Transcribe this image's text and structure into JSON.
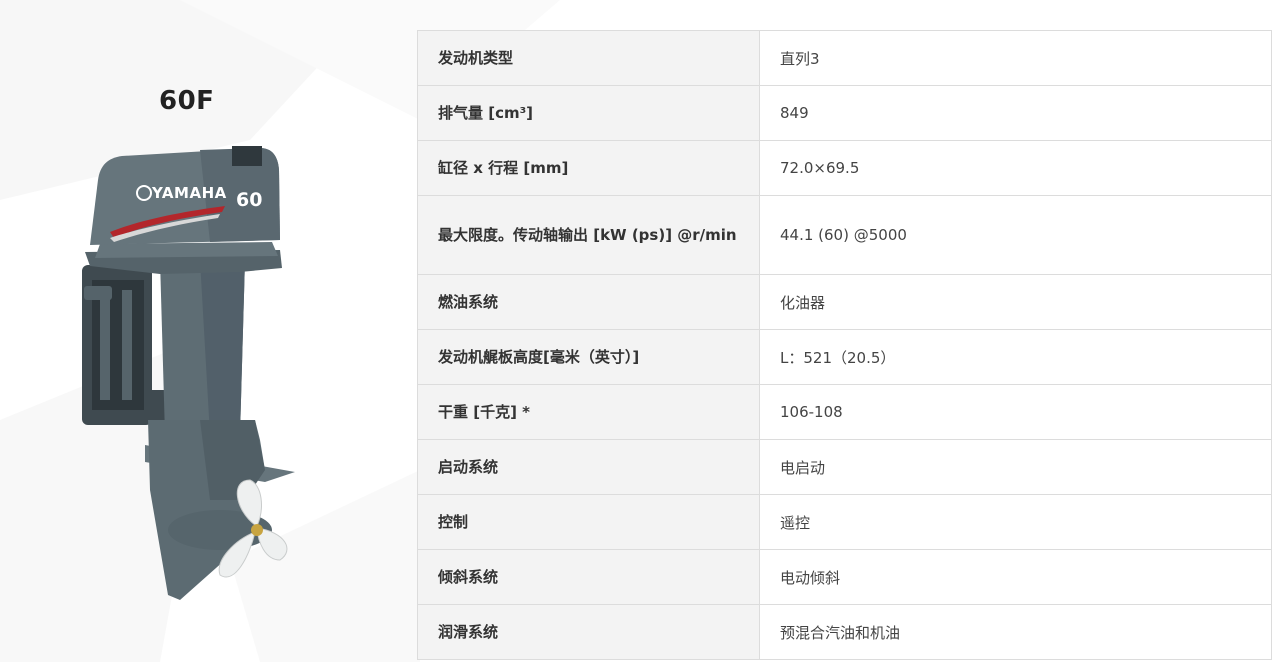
{
  "product": {
    "model": "60F",
    "image_alt": "YAMAHA 60 outboard motor",
    "brand_text": "YAMAHA",
    "cowl_number": "60"
  },
  "colors": {
    "label_bg": "#f3f3f3",
    "border": "#dcdcdc",
    "motor_body": "#5b6a71",
    "accent_red": "#b3262b"
  },
  "specs": [
    {
      "label": "发动机类型",
      "value": "直列3"
    },
    {
      "label": "排气量 [cm³]",
      "value": "849"
    },
    {
      "label": "缸径 x 行程 [mm]",
      "value": "72.0×69.5"
    },
    {
      "label": "最大限度。传动轴输出 [kW (ps)] @r/min",
      "value": "44.1 (60) @5000"
    },
    {
      "label": "燃油系统",
      "value": "化油器"
    },
    {
      "label": "发动机艉板高度[毫米（英寸）]",
      "value": "L：521（20.5）"
    },
    {
      "label": "干重 [千克] *",
      "value": "106-108"
    },
    {
      "label": "启动系统",
      "value": "电启动"
    },
    {
      "label": "控制",
      "value": "遥控"
    },
    {
      "label": "倾斜系统",
      "value": "电动倾斜"
    },
    {
      "label": "润滑系统",
      "value": "预混合汽油和机油"
    }
  ]
}
